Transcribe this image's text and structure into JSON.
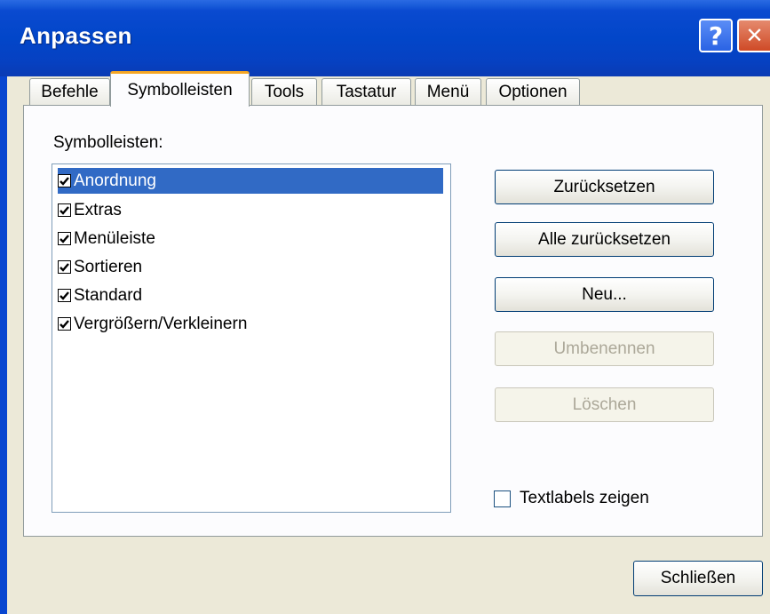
{
  "window": {
    "title": "Anpassen"
  },
  "titlebar": {
    "help_glyph": "?",
    "close_glyph": "✕"
  },
  "tabs": [
    {
      "label": "Befehle"
    },
    {
      "label": "Symbolleisten"
    },
    {
      "label": "Tools"
    },
    {
      "label": "Tastatur"
    },
    {
      "label": "Menü"
    },
    {
      "label": "Optionen"
    }
  ],
  "active_tab": "Symbolleisten",
  "toolbars": {
    "label": "Symbolleisten:",
    "items": [
      {
        "label": "Anordnung",
        "checked": true,
        "selected": true
      },
      {
        "label": "Extras",
        "checked": true,
        "selected": false
      },
      {
        "label": "Menüleiste",
        "checked": true,
        "selected": false
      },
      {
        "label": "Sortieren",
        "checked": true,
        "selected": false
      },
      {
        "label": "Standard",
        "checked": true,
        "selected": false
      },
      {
        "label": "Vergrößern/Verkleinern",
        "checked": true,
        "selected": false
      }
    ]
  },
  "buttons": {
    "reset": "Zurücksetzen",
    "reset_all": "Alle zurücksetzen",
    "new": "Neu...",
    "rename": "Umbenennen",
    "delete": "Löschen"
  },
  "text_labels": {
    "label": "Textlabels zeigen",
    "checked": false
  },
  "footer": {
    "close": "Schließen"
  },
  "colors": {
    "titlebar": "#0846D0",
    "selection": "#316AC5",
    "dialog_bg": "#ECE9D8",
    "tab_highlight": "#F5A623"
  }
}
